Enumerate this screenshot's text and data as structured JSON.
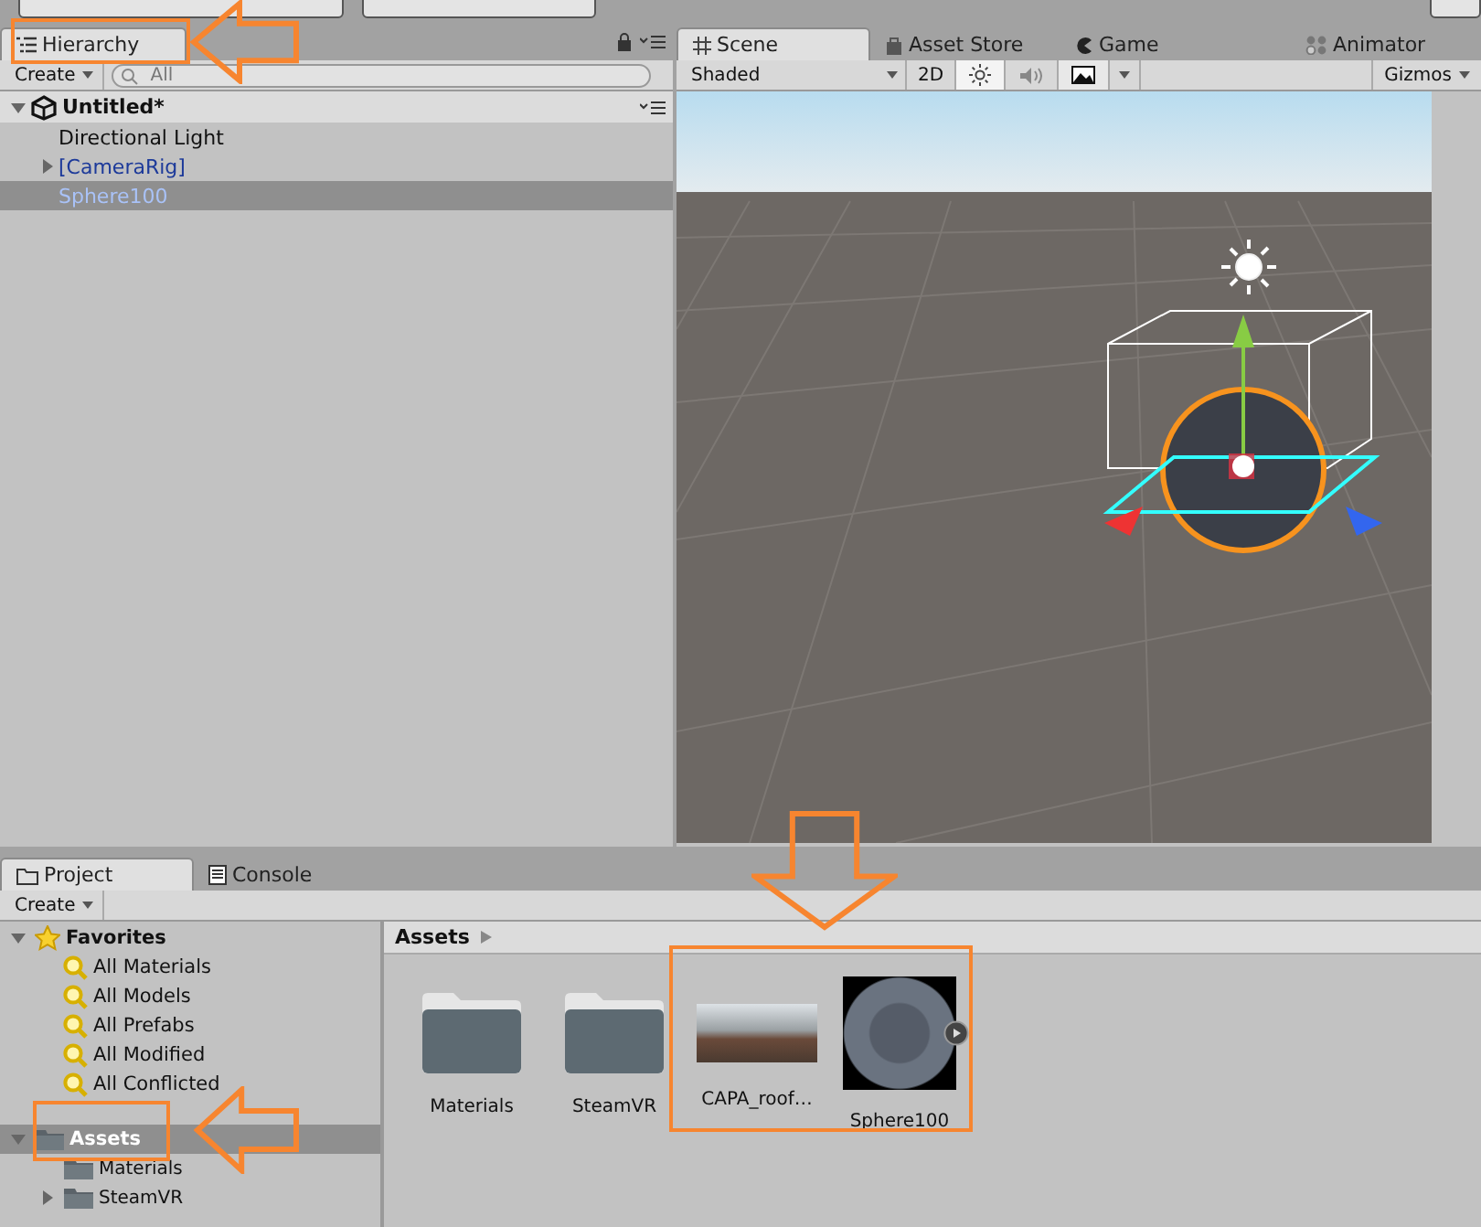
{
  "hierarchy": {
    "tab": {
      "label": "Hierarchy",
      "selected": true
    },
    "create": "Create",
    "search_placeholder": "All",
    "scene": {
      "name": "Untitled*",
      "expanded": true,
      "items": [
        {
          "label": "Directional Light",
          "kind": "object",
          "expandable": false,
          "selected": false
        },
        {
          "label": "[CameraRig]",
          "kind": "prefab",
          "expandable": true,
          "selected": false
        },
        {
          "label": "Sphere100",
          "kind": "prefab",
          "expandable": false,
          "selected": true
        }
      ]
    }
  },
  "scene_view": {
    "tabs": [
      {
        "label": "Scene",
        "kind": "scene",
        "selected": true
      },
      {
        "label": "Asset Store",
        "kind": "store",
        "selected": false
      },
      {
        "label": "Game",
        "kind": "game",
        "selected": false
      },
      {
        "label": "Animator",
        "kind": "animator",
        "selected": false
      }
    ],
    "shading": "Shaded",
    "mode_2d": "2D",
    "lighting_on": true,
    "audio_on": false,
    "effects_on": true,
    "gizmos": "Gizmos"
  },
  "project": {
    "tabs": [
      {
        "label": "Project",
        "kind": "project",
        "selected": true
      },
      {
        "label": "Console",
        "kind": "console",
        "selected": false
      }
    ],
    "create": "Create",
    "favorites": {
      "label": "Favorites",
      "expanded": true,
      "items": [
        "All Materials",
        "All Models",
        "All Prefabs",
        "All Modified",
        "All Conflicted"
      ]
    },
    "assets_tree": {
      "label": "Assets",
      "selected": true,
      "expanded": true,
      "children": [
        {
          "label": "Materials",
          "expandable": false
        },
        {
          "label": "SteamVR",
          "expandable": true
        }
      ]
    },
    "breadcrumb": "Assets",
    "assets": [
      {
        "name": "Materials",
        "kind": "folder"
      },
      {
        "name": "SteamVR",
        "kind": "folder"
      },
      {
        "name": "CAPA_roof…",
        "kind": "texture"
      },
      {
        "name": "Sphere100",
        "kind": "material"
      }
    ]
  }
}
